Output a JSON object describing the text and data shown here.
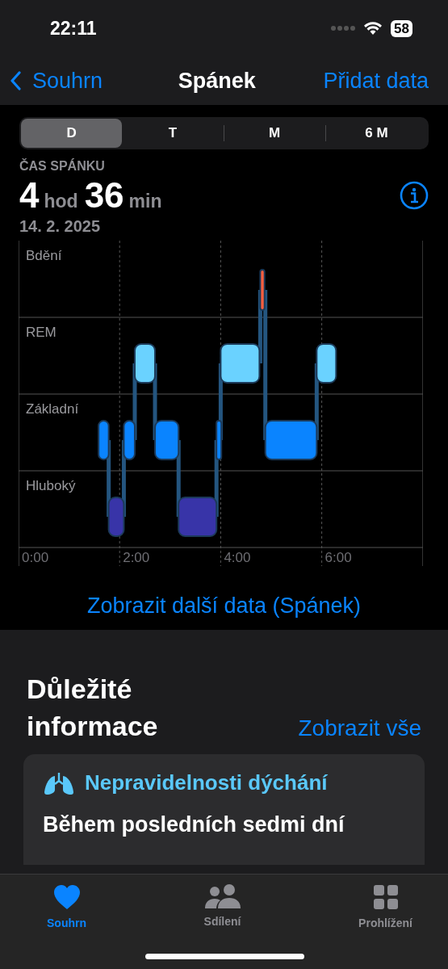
{
  "status_bar": {
    "time": "22:11",
    "battery": "58"
  },
  "nav": {
    "back": "Souhrn",
    "title": "Spánek",
    "action": "Přidat data"
  },
  "periods": [
    {
      "label": "D",
      "selected": true
    },
    {
      "label": "T",
      "selected": false
    },
    {
      "label": "M",
      "selected": false
    },
    {
      "label": "6 M",
      "selected": false
    }
  ],
  "summary": {
    "label": "ČAS SPÁNKU",
    "hours": "4",
    "hours_unit": "hod",
    "minutes": "36",
    "minutes_unit": "min",
    "date": "14. 2. 2025"
  },
  "sleep_chart": {
    "stages": [
      "Bdění",
      "REM",
      "Základní",
      "Hluboký"
    ],
    "x_labels": [
      "0:00",
      "2:00",
      "4:00",
      "6:00"
    ]
  },
  "more_link": "Zobrazit další data (Spánek)",
  "highlights": {
    "title": "Důležité informace",
    "show_all": "Zobrazit vše",
    "card": {
      "title": "Nepravidelnosti dýchání",
      "text": "Během posledních sedmi dní"
    }
  },
  "tab_bar": [
    {
      "label": "Souhrn",
      "selected": true
    },
    {
      "label": "Sdílení",
      "selected": false
    },
    {
      "label": "Prohlížení",
      "selected": false
    }
  ]
}
